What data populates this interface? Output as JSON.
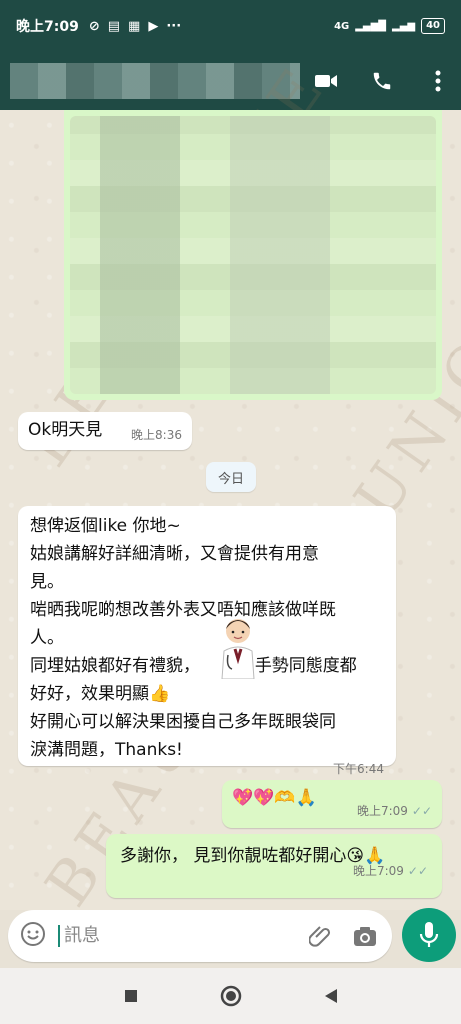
{
  "status": {
    "time": "晚上7:09",
    "icons": [
      "alarm-off",
      "notification",
      "app",
      "youtube",
      "more"
    ],
    "battery": "40",
    "signal_label": "4G"
  },
  "header": {
    "contact_name_blurred": true,
    "actions": [
      "video-call-icon",
      "phone-icon",
      "more-vert-icon"
    ]
  },
  "messages": [
    {
      "id": "m1",
      "type": "image",
      "direction": "out",
      "blurred": true
    },
    {
      "id": "m2",
      "direction": "in",
      "text": "Ok明天見",
      "time": "晚上8:36"
    },
    {
      "id": "divider",
      "type": "date",
      "text": "今日"
    },
    {
      "id": "m3",
      "direction": "in",
      "lines": [
        "想俾返個like 你地~",
        "姑娘講解好詳細清晰，又會提供有用意",
        "見。",
        "啱晒我呢啲想改善外表又唔知應該做咩既",
        "人。",
        "同埋姑娘都好有禮貌，",
        "手勢同態度都",
        "好好，效果明顯👍",
        "好開心可以解決果困擾自己多年既眼袋同",
        "淚溝問題，Thanks!"
      ],
      "time": "下午6:44"
    },
    {
      "id": "m4",
      "direction": "out",
      "text": "💖💖🫶🙏",
      "time": "晚上7:09",
      "status": "read"
    },
    {
      "id": "m5",
      "direction": "out",
      "text": "多謝你， 見到你靚咗都好開心😘🙏",
      "time": "晚上7:09",
      "status": "read"
    }
  ],
  "composer": {
    "placeholder": "訊息"
  },
  "watermark": "BEAUNIQUE",
  "colors": {
    "header": "#1f4a44",
    "outgoing": "#dcf8c6",
    "incoming": "#ffffff",
    "accent": "#0d9d7a"
  }
}
